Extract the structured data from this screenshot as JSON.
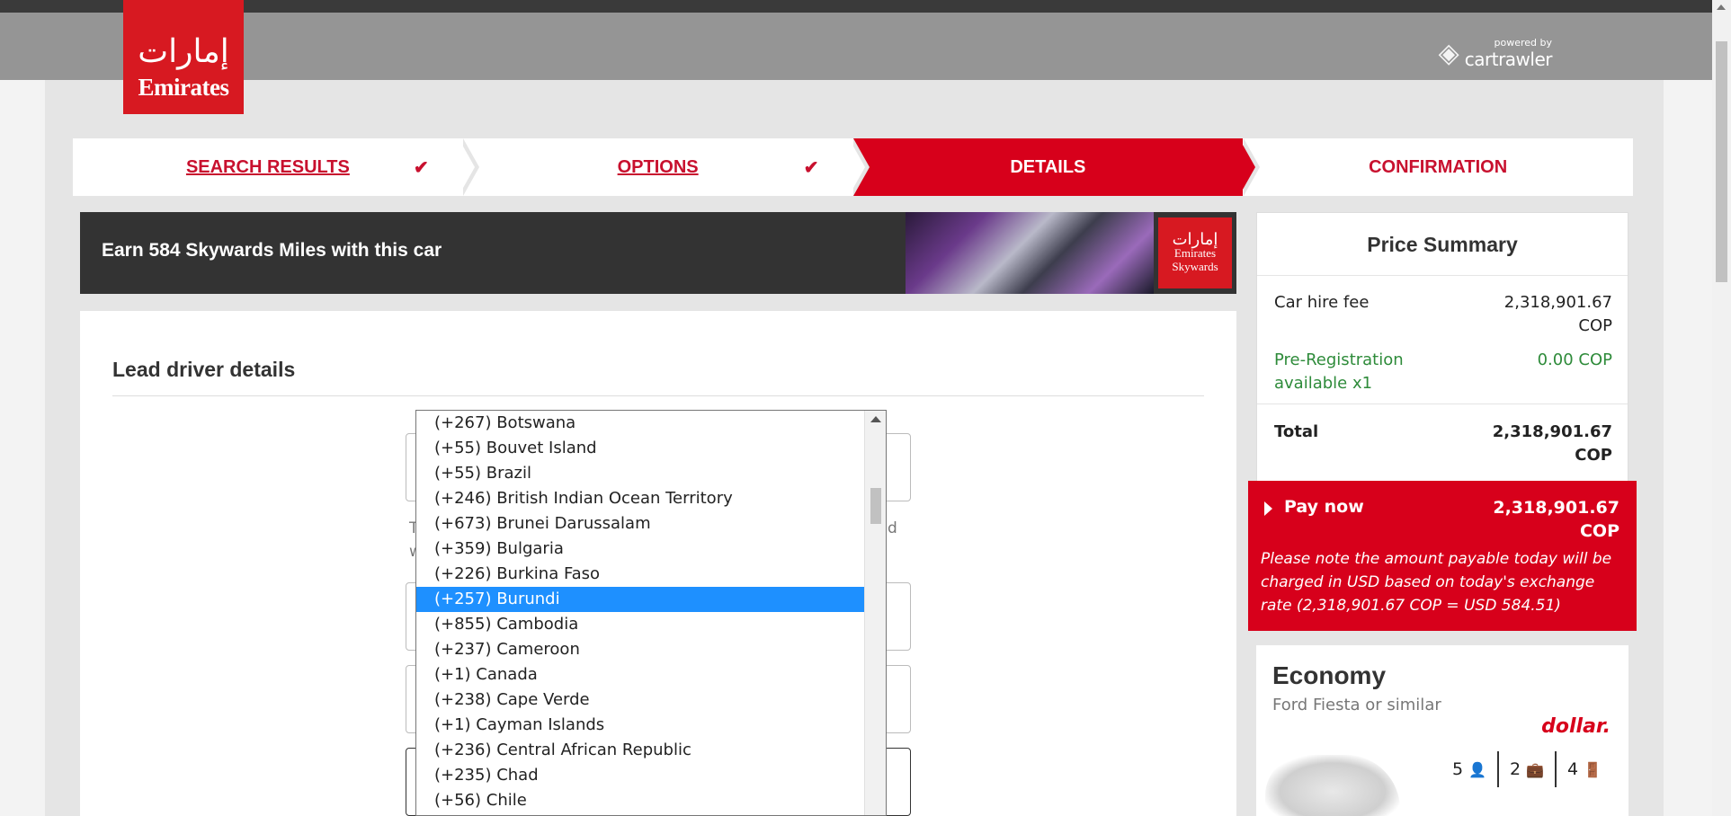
{
  "brand": {
    "logo_text": "Emirates",
    "logo_glyph": "ﺇﻣﺎﺭاﺕ",
    "powered_by": "powered by",
    "partner": "cartrawler"
  },
  "steps": [
    {
      "label": "SEARCH RESULTS",
      "done": true
    },
    {
      "label": "OPTIONS",
      "done": true
    },
    {
      "label": "DETAILS",
      "active": true
    },
    {
      "label": "CONFIRMATION"
    }
  ],
  "check_glyph": "✔",
  "promo": {
    "text": "Earn 584 Skywards Miles with this car",
    "badge_line1": "Emirates",
    "badge_line2": "Skywards"
  },
  "form": {
    "heading": "Lead driver details",
    "hint_left": "T",
    "hint_left2": "w",
    "hint_right": "d"
  },
  "country_codes": [
    "(+267) Botswana",
    "(+55) Bouvet Island",
    "(+55) Brazil",
    "(+246) British Indian Ocean Territory",
    "(+673) Brunei Darussalam",
    "(+359) Bulgaria",
    "(+226) Burkina Faso",
    "(+257) Burundi",
    "(+855) Cambodia",
    "(+237) Cameroon",
    "(+1) Canada",
    "(+238) Cape Verde",
    "(+1) Cayman Islands",
    "(+236) Central African Republic",
    "(+235) Chad",
    "(+56) Chile"
  ],
  "selected_country": "(+257) Burundi",
  "summary": {
    "title": "Price Summary",
    "car_hire_label": "Car hire fee",
    "car_hire_value": "2,318,901.67 COP",
    "prereg_label": "Pre-Registration available x1",
    "prereg_value": "0.00 COP",
    "total_label": "Total",
    "total_value": "2,318,901.67 COP"
  },
  "pay": {
    "label": "Pay now",
    "amount": "2,318,901.67 COP",
    "note": "Please note the amount payable today will be charged in USD based on today's exchange rate (2,318,901.67 COP = USD 584.51)"
  },
  "car": {
    "class": "Economy",
    "model": "Ford Fiesta or similar",
    "supplier": "dollar.",
    "seats": "5",
    "bags": "2",
    "doors": "4"
  },
  "colors": {
    "brand_red": "#d7001b",
    "selected_blue": "#1e90ff",
    "green": "#2e8b3a"
  }
}
